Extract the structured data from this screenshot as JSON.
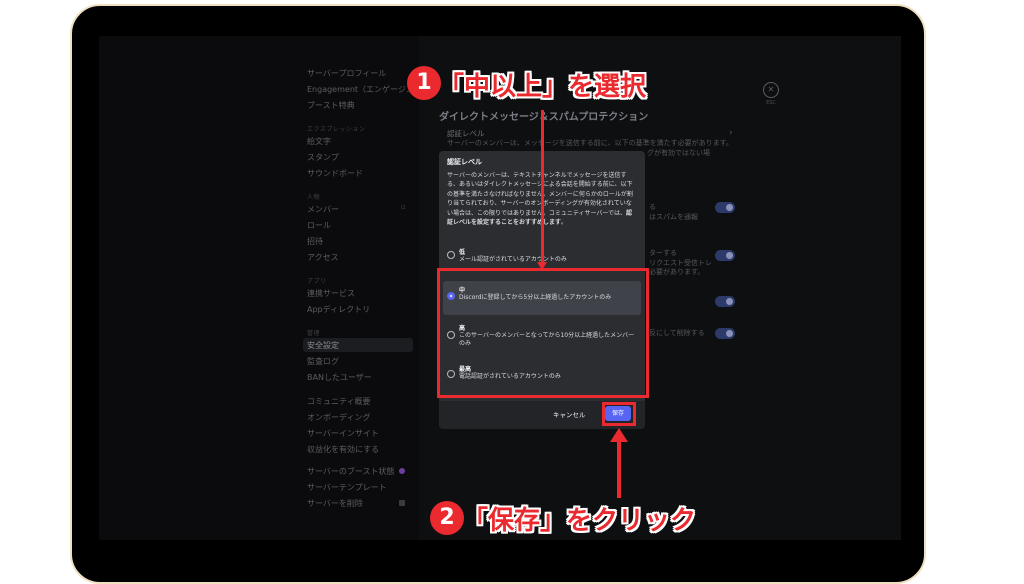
{
  "sidebar": {
    "items_top": [
      "サーバープロフィール",
      "Engagement（エンゲージメ",
      "ブースト特典"
    ],
    "section_expression": "エクスプレッション",
    "items_expression": [
      "絵文字",
      "スタンプ",
      "サウンドボード"
    ],
    "section_people": "人物",
    "items_people": [
      "メンバー",
      "ロール",
      "招待",
      "アクセス"
    ],
    "section_apps": "アプリ",
    "items_apps": [
      "連携サービス",
      "Appディレクトリ"
    ],
    "section_moderation": "管理",
    "items_moderation": [
      "安全設定",
      "監査ログ",
      "BANしたユーザー"
    ],
    "items_community": [
      "コミュニティ概要",
      "オンボーディング",
      "サーバーインサイト",
      "収益化を有効にする"
    ],
    "items_bottom": [
      "サーバーのブースト状態",
      "サーバーテンプレート",
      "サーバーを削除"
    ]
  },
  "content": {
    "section_title": "ダイレクトメッセージ＆スパムプロテクション",
    "row_title": "認証レベル",
    "row_desc_1": "サーバーのメンバーは、メッセージを送信する前に、以下の基準を満たす必要があります。",
    "row_desc_2": "グが有効ではない場",
    "frag_1": "る",
    "frag_2": "はスパムを通報",
    "frag_3": "ターする",
    "frag_4": "リクエスト受信トレ",
    "frag_5": "必要があります。",
    "frag_6": "反にして削除する",
    "esc_label": "ESC"
  },
  "modal": {
    "title": "認証レベル",
    "description_1": "サーバーのメンバーは、テキストチャンネルでメッセージを送信する、あるいはダイレクトメッセージによる会話を開始する前に、以下の基準を満たさなければなりません。メンバーに何らかのロールが割り当てられており、サーバーのオンボーディングが有効化されていない場合は、この限りではありません。コミュニティサーバーでは、",
    "description_bold": "認証レベルを設定することをおすすめします",
    "description_end": "。",
    "options": [
      {
        "title": "低",
        "desc": "メール認証がされているアカウントのみ"
      },
      {
        "title": "中",
        "desc": "Discordに登録してから5分以上経過したアカウントのみ"
      },
      {
        "title": "高",
        "desc": "このサーバーのメンバーとなってから10分以上経過したメンバーのみ"
      },
      {
        "title": "最高",
        "desc": "電話認証がされているアカウントのみ"
      }
    ],
    "selected": "中",
    "cancel_label": "キャンセル",
    "save_label": "保存"
  },
  "annotations": {
    "step1_number": "1",
    "step1_text": "「中以上」を選択",
    "step2_number": "2",
    "step2_text": "「保存」をクリック",
    "accent_color": "#ea2a2f"
  },
  "colors": {
    "modal_bg": "#2b2d31",
    "footer_bg": "#232428",
    "primary": "#5865f2"
  }
}
